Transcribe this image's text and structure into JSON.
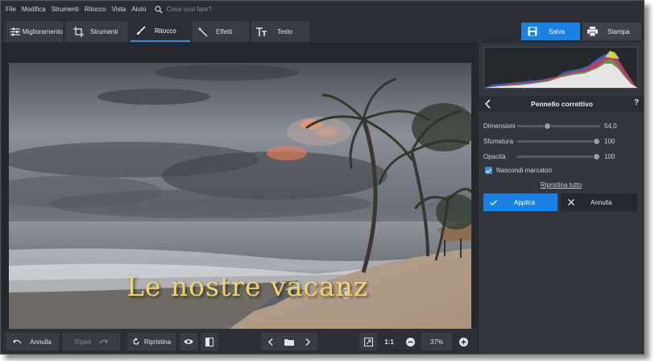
{
  "menu": {
    "items": [
      "File",
      "Modifica",
      "Strumenti",
      "Ritocco",
      "Vista",
      "Aiuto"
    ],
    "search_placeholder": "Cosa vuoi fare?"
  },
  "toolbar": {
    "tabs": [
      {
        "label": "Miglioramento",
        "icon": "sliders-icon"
      },
      {
        "label": "Strumenti",
        "icon": "crop-icon"
      },
      {
        "label": "Ritocco",
        "icon": "brush-icon",
        "active": true
      },
      {
        "label": "Effetti",
        "icon": "magic-wand-icon"
      },
      {
        "label": "Testo",
        "icon": "text-icon"
      }
    ],
    "save_label": "Salva",
    "print_label": "Stampa"
  },
  "photo": {
    "caption": "Le nostre vacanz"
  },
  "bottombar": {
    "undo_label": "Annulla",
    "redo_label": "Ripeti",
    "restore_label": "Ripristina",
    "ratio_label": "1:1",
    "zoom_value": "37%"
  },
  "panel": {
    "title": "Pennello correttivo",
    "help": "?",
    "sliders": [
      {
        "label": "Dimensioni",
        "value": "54,0",
        "fraction": 0.36
      },
      {
        "label": "Sfumatura",
        "value": "100",
        "fraction": 1.0
      },
      {
        "label": "Opacità",
        "value": "100",
        "fraction": 1.0
      }
    ],
    "hide_markers_label": "Nascondi marcatori",
    "hide_markers_checked": true,
    "reset_all_label": "Ripristina tutto",
    "apply_label": "Applica",
    "cancel_label": "Annulla"
  },
  "colors": {
    "accent": "#1a82e2",
    "background": "#2b2e33",
    "panel": "#33363b"
  }
}
